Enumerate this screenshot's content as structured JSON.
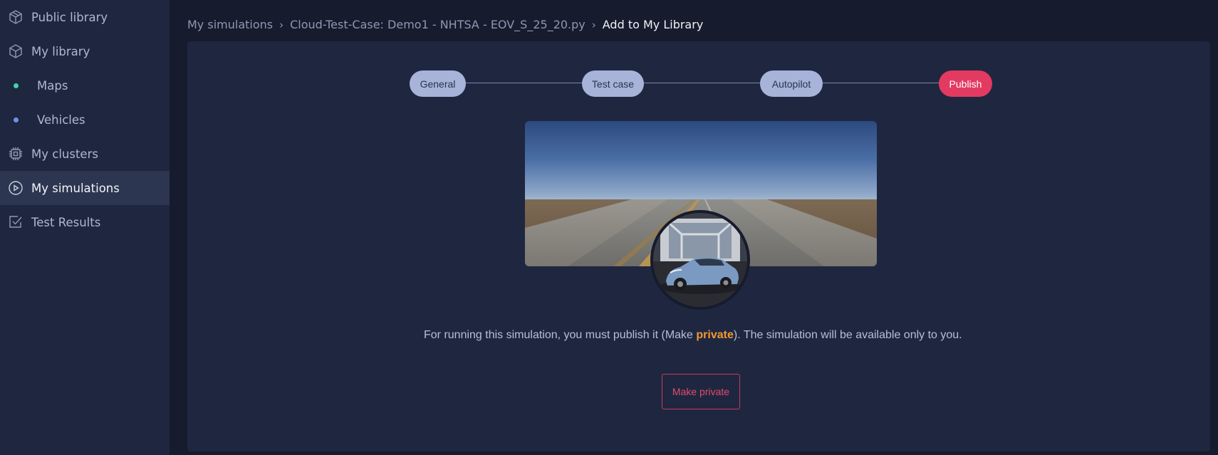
{
  "sidebar": {
    "items": [
      {
        "label": "Public library",
        "icon": "cube-outline-icon"
      },
      {
        "label": "My library",
        "icon": "cube-icon"
      },
      {
        "label": "Maps",
        "icon": "dot-icon",
        "dot_color": "#3ed6a5"
      },
      {
        "label": "Vehicles",
        "icon": "dot-icon",
        "dot_color": "#6f8ff0"
      },
      {
        "label": "My clusters",
        "icon": "chip-icon"
      },
      {
        "label": "My simulations",
        "icon": "play-circle-icon",
        "active": true
      },
      {
        "label": "Test Results",
        "icon": "checkbox-icon"
      }
    ]
  },
  "breadcrumb": {
    "items": [
      "My simulations",
      "Cloud-Test-Case: Demo1 - NHTSA - EOV_S_25_20.py",
      "Add to My Library"
    ],
    "separator": "›"
  },
  "stepper": {
    "steps": [
      {
        "label": "General",
        "active": false
      },
      {
        "label": "Test case",
        "active": false
      },
      {
        "label": "Autopilot",
        "active": false
      },
      {
        "label": "Publish",
        "active": true
      }
    ]
  },
  "message": {
    "before": "For running this simulation, you must publish it (Make ",
    "highlight": "private",
    "after": "). The simulation will be available only to you."
  },
  "actions": {
    "make_private_label": "Make private"
  },
  "colors": {
    "accent": "#e33a62",
    "highlight": "#f29a2e",
    "step_inactive": "#a7b3d8",
    "panel": "#1f2740",
    "background": "#161b2d"
  }
}
